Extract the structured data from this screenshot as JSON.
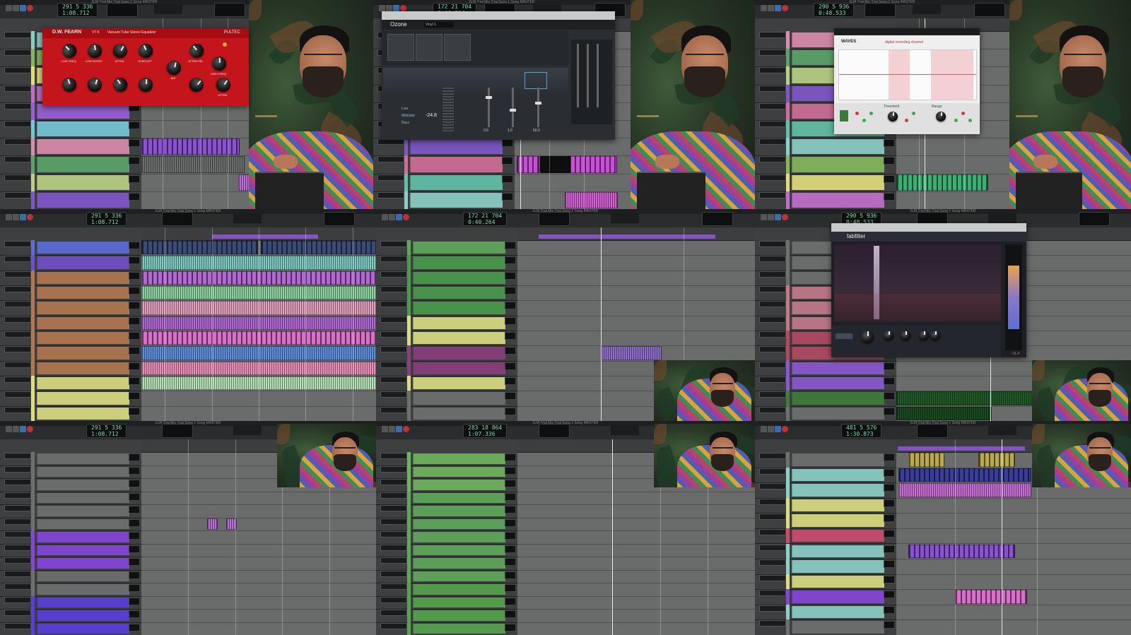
{
  "window": {
    "title": "GJA Trial Mix Trial Song 1 Song MASTER"
  },
  "counters": {
    "c1_main": "291 5 336",
    "c1_sub": "1:08.712",
    "c2_main": "172 21 704",
    "c2_sub": "0:40.264",
    "c3_main": "290 5 936",
    "c3_sub": "0:48.533",
    "c4_main": "283 18 864",
    "c4_sub": "1:07.336",
    "c5_main": "481 5 576",
    "c5_sub": "1:30.873"
  },
  "plugin_ssl": {
    "brand_left": "D.W. FEARN",
    "model_left": "VT-5",
    "subtitle": "Vacuum Tube Stereo Equalizer",
    "brand_right": "PULTEC",
    "knob_labels": [
      "LOW FREQ",
      "LOW BOOST",
      "ATTEN",
      "HI BOOST",
      "BW",
      "ATTEN SEL",
      "HIGH FREQ",
      "ATTEN"
    ]
  },
  "plugin_ozone": {
    "name": "Ozone",
    "preset": "Vinyl 1",
    "reading": "-24.8",
    "side_items": [
      "Low",
      "Mid/side",
      "Bass"
    ],
    "values": [
      "0.0",
      "1.0",
      "50.0"
    ]
  },
  "plugin_waves": {
    "brand": "WAVES",
    "title": "digital recording channel",
    "section_a": "Threshold",
    "section_b": "Range"
  },
  "plugin_fabfilter": {
    "brand": "fabfilter",
    "readout": "-11.4"
  }
}
